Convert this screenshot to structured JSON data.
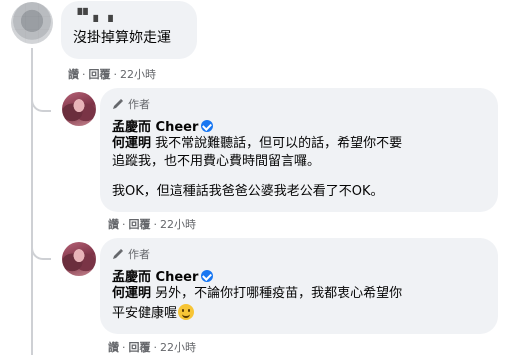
{
  "comments": [
    {
      "author_name": "▝▘▖▗",
      "text": "沒掛掉算妳走運",
      "actions": {
        "like": "讚",
        "reply": "回覆",
        "time": "22小時",
        "sep": "·"
      }
    }
  ],
  "replies": [
    {
      "badge": "作者",
      "author_name": "孟慶而 Cheer",
      "mention": "何運明",
      "line1": "我不常說難聽話，但可以的話，希望你不要",
      "line2": "追蹤我，也不用費心費時間留言囉。",
      "line3": "我OK，但這種話我爸爸公婆我老公看了不OK。",
      "actions": {
        "like": "讚",
        "reply": "回覆",
        "time": "22小時",
        "sep": "·"
      }
    },
    {
      "badge": "作者",
      "author_name": "孟慶而 Cheer",
      "mention": "何運明",
      "line1": "另外，不論你打哪種疫苗，我都衷心希望你",
      "line2": "平安健康喔",
      "actions": {
        "like": "讚",
        "reply": "回覆",
        "time": "22小時",
        "sep": "·"
      }
    }
  ]
}
